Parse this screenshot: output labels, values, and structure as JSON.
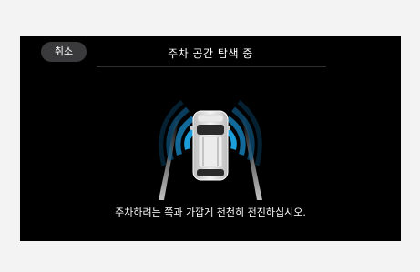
{
  "header": {
    "cancel_label": "취소",
    "title": "주차 공간 탐색 중"
  },
  "instruction": "주차하려는 쪽과 가깝게 천천히 전진하십시오.",
  "icons": {
    "vehicle": "car-topview-icon",
    "left_sensor": "sensor-wave-left-icon",
    "right_sensor": "sensor-wave-right-icon"
  },
  "colors": {
    "screen_bg": "#000000",
    "sensor_accent": "#1ea7e6",
    "text": "#ffffff",
    "button_bg": "#3a3a3c"
  }
}
